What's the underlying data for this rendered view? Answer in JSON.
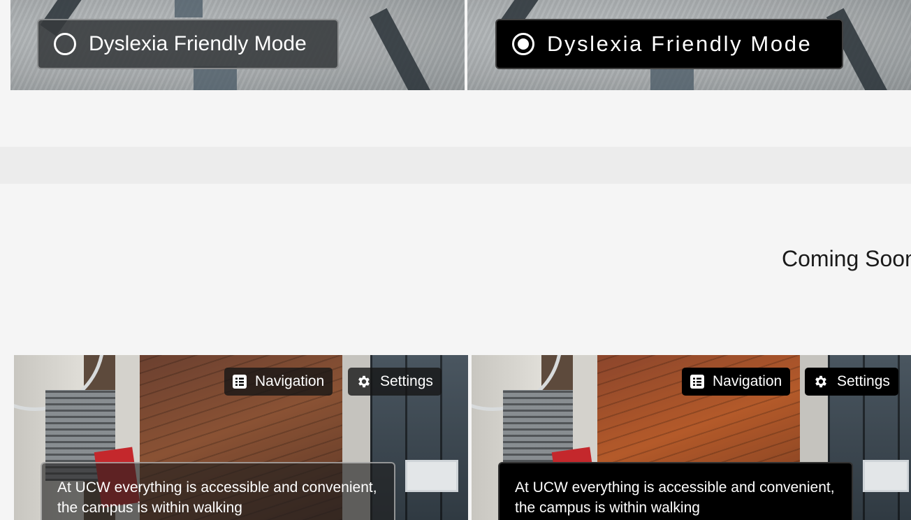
{
  "top_panels": [
    {
      "mode_label": "Dyslexia Friendly Mode",
      "selected": false
    },
    {
      "mode_label": "Dyslexia Friendly Mode",
      "selected": true
    }
  ],
  "coming_soon": "Coming Soon",
  "bottom_panels": [
    {
      "nav_label": "Navigation",
      "settings_label": "Settings",
      "description": "At UCW everything is accessible and convenient, the campus is within walking"
    },
    {
      "nav_label": "Navigation",
      "settings_label": "Settings",
      "description": "At UCW everything is accessible and convenient, the campus is within walking"
    }
  ],
  "icons": [
    "list-icon",
    "gear-icon",
    "radio-empty-icon",
    "radio-filled-icon"
  ]
}
